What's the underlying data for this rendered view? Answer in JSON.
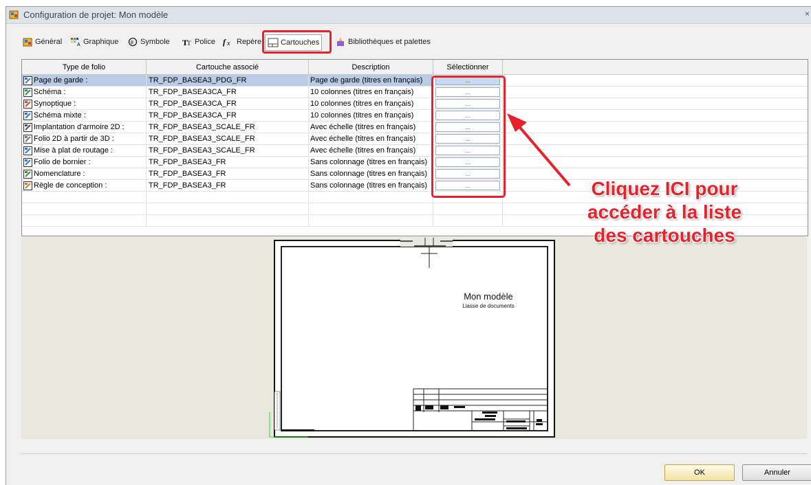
{
  "window": {
    "title": "Configuration de projet: Mon modèle",
    "close_glyph": "×"
  },
  "tabs": [
    {
      "label": "Général",
      "icon": "project-icon"
    },
    {
      "label": "Graphique",
      "icon": "graphic-icon"
    },
    {
      "label": "Symbole",
      "icon": "symbol-icon"
    },
    {
      "label": "Police",
      "icon": "font-icon"
    },
    {
      "label": "Repère",
      "icon": "function-icon"
    },
    {
      "label": "Cartouches",
      "icon": "title-block-icon",
      "active": true
    },
    {
      "label": "Bibliothèques et palettes",
      "icon": "library-icon"
    }
  ],
  "table": {
    "headers": [
      "Type de folio",
      "Cartouche associé",
      "Description",
      "Sélectionner"
    ],
    "rows": [
      {
        "type": "Page de garde :",
        "cartouche": "TR_FDP_BASEA3_PDG_FR",
        "description": "Page de garde (titres en français)",
        "select": "...",
        "selected": true
      },
      {
        "type": "Schéma :",
        "cartouche": "TR_FDP_BASEA3CA_FR",
        "description": "10 colonnes (titres en français)",
        "select": "..."
      },
      {
        "type": "Synoptique :",
        "cartouche": "TR_FDP_BASEA3CA_FR",
        "description": "10 colonnes (titres en français)",
        "select": "..."
      },
      {
        "type": "Schéma mixte :",
        "cartouche": "TR_FDP_BASEA3CA_FR",
        "description": "10 colonnes (titres en français)",
        "select": "..."
      },
      {
        "type": "Implantation d'armoire 2D :",
        "cartouche": "TR_FDP_BASEA3_SCALE_FR",
        "description": "Avec échelle (titres en français)",
        "select": "..."
      },
      {
        "type": "Folio 2D à partir de 3D :",
        "cartouche": "TR_FDP_BASEA3_SCALE_FR",
        "description": "Avec échelle (titres en français)",
        "select": "..."
      },
      {
        "type": "Mise à plat de routage :",
        "cartouche": "TR_FDP_BASEA3_SCALE_FR",
        "description": "Avec échelle (titres en français)",
        "select": "..."
      },
      {
        "type": "Folio de bornier :",
        "cartouche": "TR_FDP_BASEA3_FR",
        "description": "Sans colonnage (titres en français)",
        "select": "..."
      },
      {
        "type": "Nomenclature :",
        "cartouche": "TR_FDP_BASEA3_FR",
        "description": "Sans colonnage (titres en français)",
        "select": "..."
      },
      {
        "type": "Règle de conception :",
        "cartouche": "TR_FDP_BASEA3_FR",
        "description": "Sans colonnage (titres en français)",
        "select": "..."
      }
    ]
  },
  "preview": {
    "title": "Mon modèle",
    "subtitle": "Liasse de documents"
  },
  "callout": {
    "line1": "Cliquez ICI pour",
    "line2": "accéder à la liste",
    "line3": "des cartouches"
  },
  "buttons": {
    "ok": "OK",
    "cancel": "Annuler"
  },
  "colors": {
    "highlight": "#e8222a",
    "selected_row": "#b9cbe6"
  }
}
